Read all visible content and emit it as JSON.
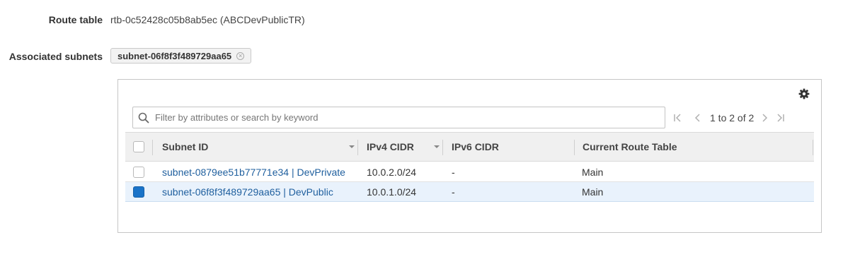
{
  "route_table": {
    "label": "Route table",
    "value": "rtb-0c52428c05b8ab5ec (ABCDevPublicTR)"
  },
  "associated_subnets": {
    "label": "Associated subnets",
    "tokens": [
      {
        "label": "subnet-06f8f3f489729aa65",
        "remove_icon": "close-circle-icon"
      }
    ]
  },
  "table": {
    "settings_icon": "gear-icon",
    "search": {
      "placeholder": "Filter by attributes or search by keyword",
      "value": ""
    },
    "pagination": {
      "text": "1 to 2 of 2"
    },
    "columns": [
      {
        "label": "Subnet ID",
        "sortable": true
      },
      {
        "label": "IPv4 CIDR",
        "sortable": true
      },
      {
        "label": "IPv6 CIDR",
        "sortable": false
      },
      {
        "label": "Current Route Table",
        "sortable": false
      }
    ],
    "rows": [
      {
        "subnet_id": "subnet-0879ee51b77771e34 | DevPrivate",
        "ipv4": "10.0.2.0/24",
        "ipv6": "-",
        "route_table": "Main",
        "selected": false
      },
      {
        "subnet_id": "subnet-06f8f3f489729aa65 | DevPublic",
        "ipv4": "10.0.1.0/24",
        "ipv6": "-",
        "route_table": "Main",
        "selected": true
      }
    ]
  },
  "colors": {
    "link": "#1f5f9e",
    "selected_row": "#e9f2fc",
    "checkbox_checked": "#1a73c8"
  }
}
